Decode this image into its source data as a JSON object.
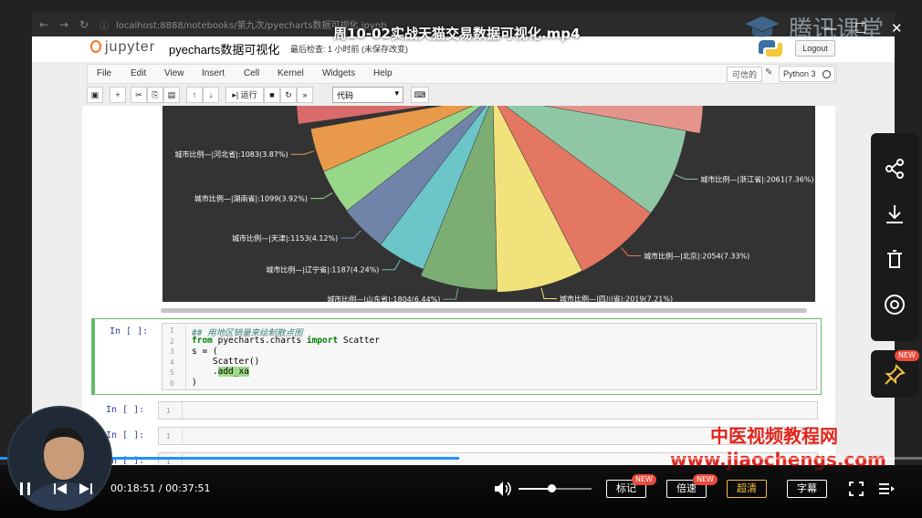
{
  "video": {
    "title": "周10-02实战天猫交易数据可视化.mp4",
    "watermark_brand": "腾讯课堂",
    "overlay_site_name": "中医视频教程网",
    "overlay_site_url": "www.jiaochengs.com",
    "time_current": "00:18:51",
    "time_total": "00:37:51",
    "time_display": "00:18:51 / 00:37:51",
    "progress": 0.498,
    "volume": 0.45,
    "buttons": {
      "bookmark": "标记",
      "speed": "倍速",
      "quality": "超清",
      "subtitle": "字幕"
    },
    "badge_new": "NEW"
  },
  "browser": {
    "url": "localhost:8888/notebooks/第九次/pyecharts数据可视化.ipynb"
  },
  "jupyter": {
    "logo_text": "jupyter",
    "notebook_title": "pyecharts数据可视化",
    "checkpoint": "最后检查: 1 小时前  (未保存改变)",
    "logout": "Logout",
    "menu": [
      "File",
      "Edit",
      "View",
      "Insert",
      "Cell",
      "Kernel",
      "Widgets",
      "Help"
    ],
    "trusted": "可信的",
    "kernel": "Python 3",
    "toolbar": {
      "run_label": "运行",
      "cell_type": "代码"
    }
  },
  "cells": [
    {
      "prompt": "In [ ]:",
      "lines": [
        {
          "n": "1",
          "text": "## 用地区销量来绘制散点图"
        },
        {
          "n": "2",
          "from": "from",
          "module": " pyecharts.charts ",
          "import": "import",
          "name": " Scatter"
        },
        {
          "n": "3",
          "text": "s = ("
        },
        {
          "n": "4",
          "text": "    Scatter()"
        },
        {
          "n": "5",
          "prefix": "    .",
          "hl": "add_xa"
        },
        {
          "n": "6",
          "text": ")"
        }
      ]
    },
    {
      "prompt": "In [ ]:",
      "n": "1"
    },
    {
      "prompt": "In [ ]:",
      "n": "1"
    },
    {
      "prompt": "In [ ]:",
      "n": "1"
    }
  ],
  "chart_data": {
    "type": "pie",
    "series_label_prefix": "城市比例—",
    "labels": [
      "城市比例—|河北省|:1083(3.87%)",
      "城市比例—|湖南省|:1099(3.92%)",
      "城市比例—|天津|:1153(4.12%)",
      "城市比例—|辽宁省|:1187(4.24%)",
      "城市比例—|山东省|:1804(6.44%)",
      "城市比例—|四川省|:2019(7.21%)",
      "城市比例—|北京|:2054(7.33%)",
      "城市比例—|浙江省|:2061(7.36%)"
    ],
    "slices": [
      {
        "name": "河北省",
        "value": 1083,
        "percent": 3.87,
        "color": "#e8994a"
      },
      {
        "name": "湖南省",
        "value": 1099,
        "percent": 3.92,
        "color": "#98d68a"
      },
      {
        "name": "天津",
        "value": 1153,
        "percent": 4.12,
        "color": "#6f84a8"
      },
      {
        "name": "辽宁省",
        "value": 1187,
        "percent": 4.24,
        "color": "#6cc5c8"
      },
      {
        "name": "山东省",
        "value": 1804,
        "percent": 6.44,
        "color": "#7cae74"
      },
      {
        "name": "四川省",
        "value": 2019,
        "percent": 7.21,
        "color": "#f1e27c"
      },
      {
        "name": "北京",
        "value": 2054,
        "percent": 7.33,
        "color": "#e37762"
      },
      {
        "name": "浙江省",
        "value": 2061,
        "percent": 7.36,
        "color": "#8fc7a4"
      }
    ]
  }
}
